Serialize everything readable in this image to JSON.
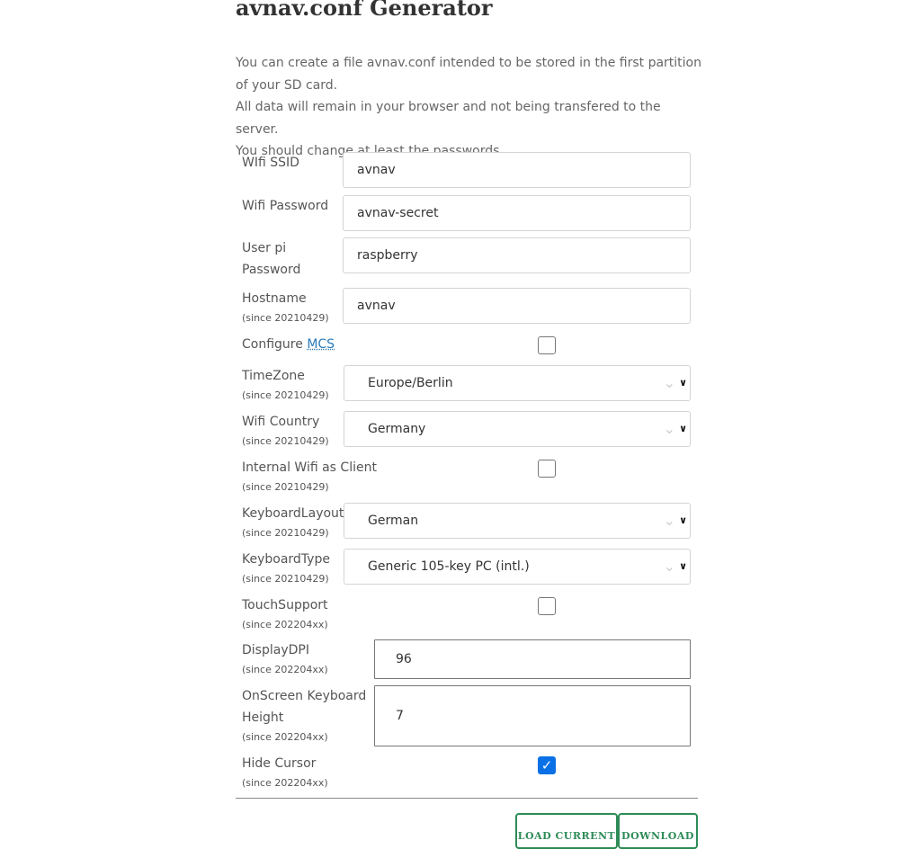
{
  "page_title": "avnav.conf Generator",
  "intro": {
    "line1": "You can create a file avnav.conf intended to be stored in the first partition of your SD card.",
    "line2": "All data will remain in your browser and not being transfered to the server.",
    "line3": "You should change at least the passwords."
  },
  "form": {
    "wifi_ssid": {
      "label": "WIfi SSID",
      "value": "avnav"
    },
    "wifi_password": {
      "label": "Wifi Password",
      "value": "avnav-secret"
    },
    "user_pi_password": {
      "label": "User pi Password",
      "value": "raspberry"
    },
    "hostname": {
      "label": "Hostname",
      "since": "(since 20210429)",
      "value": "avnav"
    },
    "configure_mcs": {
      "label_prefix": "Configure ",
      "link": "MCS",
      "checked": false
    },
    "timezone": {
      "label": "TimeZone",
      "since": "(since 20210429)",
      "value": "Europe/Berlin"
    },
    "wifi_country": {
      "label": "Wifi Country",
      "since": "(since 20210429)",
      "value": "Germany"
    },
    "internal_wifi_client": {
      "label": "Internal Wifi as Client",
      "since": "(since 20210429)",
      "checked": false
    },
    "keyboard_layout": {
      "label": "KeyboardLayout",
      "since": "(since 20210429)",
      "value": "German"
    },
    "keyboard_type": {
      "label": "KeyboardType",
      "since": "(since 20210429)",
      "value": "Generic 105-key PC (intl.)"
    },
    "touch_support": {
      "label": "TouchSupport",
      "since": "(since 202204xx)",
      "checked": false
    },
    "display_dpi": {
      "label": "DisplayDPI",
      "since": "(since 202204xx)",
      "value": "96"
    },
    "onscreen_keyboard_height": {
      "label": "OnScreen Keyboard Height",
      "since": "(since 202204xx)",
      "value": "7"
    },
    "hide_cursor": {
      "label": "Hide Cursor",
      "since": "(since 202204xx)",
      "checked": true
    }
  },
  "buttons": {
    "load_current": "Load current",
    "download": "Download"
  },
  "colors": {
    "button_accent": "#2e8b57",
    "link": "#2a7ab8",
    "checkbox_checked": "#0a70e6"
  },
  "icons": {
    "select_arrow": "chevron-down-icon",
    "checkbox_mark": "check-icon"
  }
}
